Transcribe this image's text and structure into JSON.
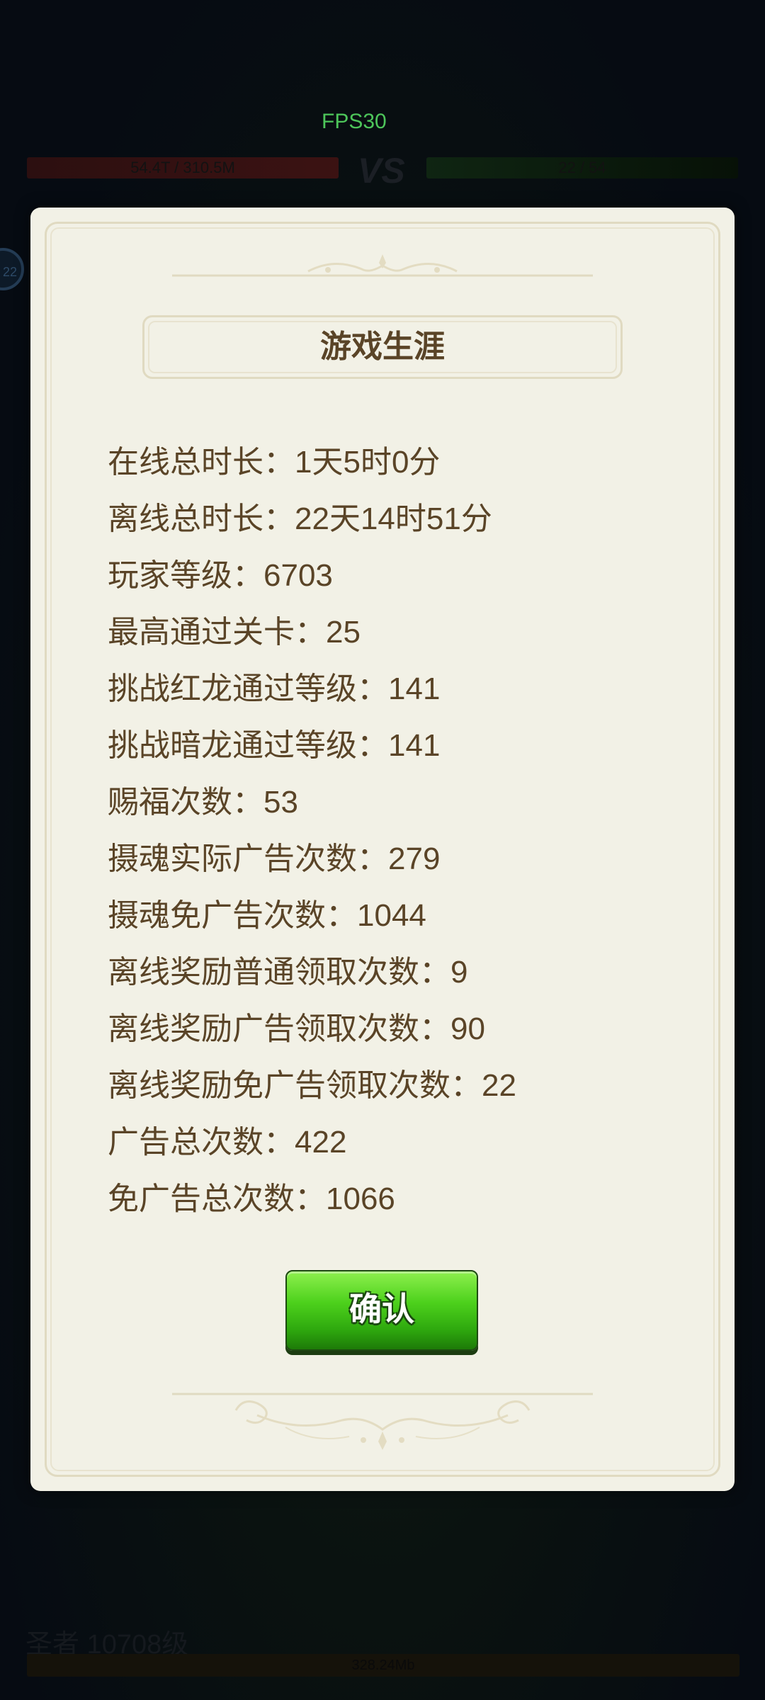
{
  "game": {
    "fps_text": "FPS30",
    "left_hp_text": "54.4T / 310.5M",
    "vs_text": "VS",
    "right_hp_text": "22 / 54",
    "badge_text": "22",
    "bottom_title": "圣者 10708级",
    "bottom_bar_text": "328.24Mb"
  },
  "modal": {
    "title": "游戏生涯",
    "stats": [
      "在线总时长：1天5时0分",
      "离线总时长：22天14时51分",
      "玩家等级：6703",
      "最高通过关卡：25",
      "挑战红龙通过等级：141",
      "挑战暗龙通过等级：141",
      "赐福次数：53",
      "摄魂实际广告次数：279",
      "摄魂免广告次数：1044",
      "离线奖励普通领取次数：9",
      "离线奖励广告领取次数：90",
      "离线奖励免广告领取次数：22",
      "广告总次数：422",
      "免广告总次数：1066"
    ],
    "confirm_label": "确认"
  },
  "colors": {
    "panel_bg": "#f2f1e6",
    "text_brown": "#5a4427",
    "button_green": "#4dd11c",
    "fps_green": "#4dc55a"
  }
}
